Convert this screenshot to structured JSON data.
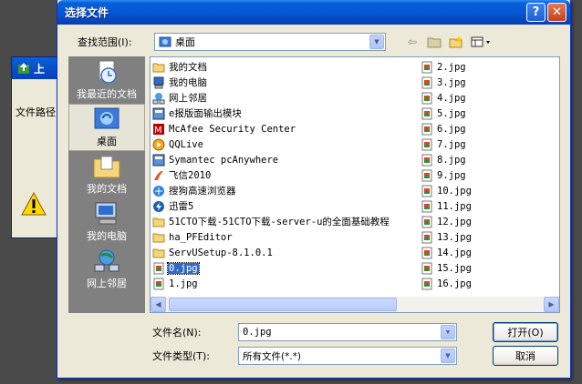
{
  "background_window": {
    "title": "上",
    "label": "文件路径"
  },
  "dialog": {
    "title": "选择文件",
    "help_glyph": "?",
    "close_glyph": "✕"
  },
  "lookin": {
    "label": "查找范围(I):",
    "value": "桌面"
  },
  "places": [
    {
      "label": "我最近的文档",
      "icon": "recent-documents-icon"
    },
    {
      "label": "桌面",
      "icon": "desktop-icon",
      "selected": true
    },
    {
      "label": "我的文档",
      "icon": "my-documents-icon"
    },
    {
      "label": "我的电脑",
      "icon": "my-computer-icon"
    },
    {
      "label": "网上邻居",
      "icon": "network-places-icon"
    }
  ],
  "files_col1": [
    {
      "name": "我的文档",
      "icon": "folder"
    },
    {
      "name": "我的电脑",
      "icon": "computer"
    },
    {
      "name": "网上邻居",
      "icon": "network"
    },
    {
      "name": "e报版面输出模块",
      "icon": "app"
    },
    {
      "name": "McAfee Security Center",
      "icon": "mcafee"
    },
    {
      "name": "QQLive",
      "icon": "qqlive"
    },
    {
      "name": "Symantec pcAnywhere",
      "icon": "app"
    },
    {
      "name": "飞信2010",
      "icon": "fetion"
    },
    {
      "name": "搜狗高速浏览器",
      "icon": "browser"
    },
    {
      "name": "迅雷5",
      "icon": "thunder"
    },
    {
      "name": "51CTO下载-51CTO下载-server-u的全面基础教程",
      "icon": "folder"
    },
    {
      "name": "ha_PFEditor",
      "icon": "folder"
    },
    {
      "name": "ServUSetup-8.1.0.1",
      "icon": "folder"
    },
    {
      "name": "0.jpg",
      "icon": "jpg",
      "selected": true
    },
    {
      "name": "1.jpg",
      "icon": "jpg"
    }
  ],
  "files_col2": [
    {
      "name": "2.jpg"
    },
    {
      "name": "3.jpg"
    },
    {
      "name": "4.jpg"
    },
    {
      "name": "5.jpg"
    },
    {
      "name": "6.jpg"
    },
    {
      "name": "7.jpg"
    },
    {
      "name": "8.jpg"
    },
    {
      "name": "9.jpg"
    },
    {
      "name": "10.jpg"
    },
    {
      "name": "11.jpg"
    },
    {
      "name": "12.jpg"
    },
    {
      "name": "13.jpg"
    },
    {
      "name": "14.jpg"
    },
    {
      "name": "15.jpg"
    },
    {
      "name": "16.jpg"
    }
  ],
  "filename": {
    "label": "文件名(N):",
    "value": "0.jpg"
  },
  "filetype": {
    "label": "文件类型(T):",
    "value": "所有文件(*.*)"
  },
  "buttons": {
    "open": "打开(O)",
    "cancel": "取消"
  },
  "colors": {
    "titlebar": "#0458d6",
    "selection": "#316ac5",
    "dialog_bg": "#ece9d8"
  }
}
